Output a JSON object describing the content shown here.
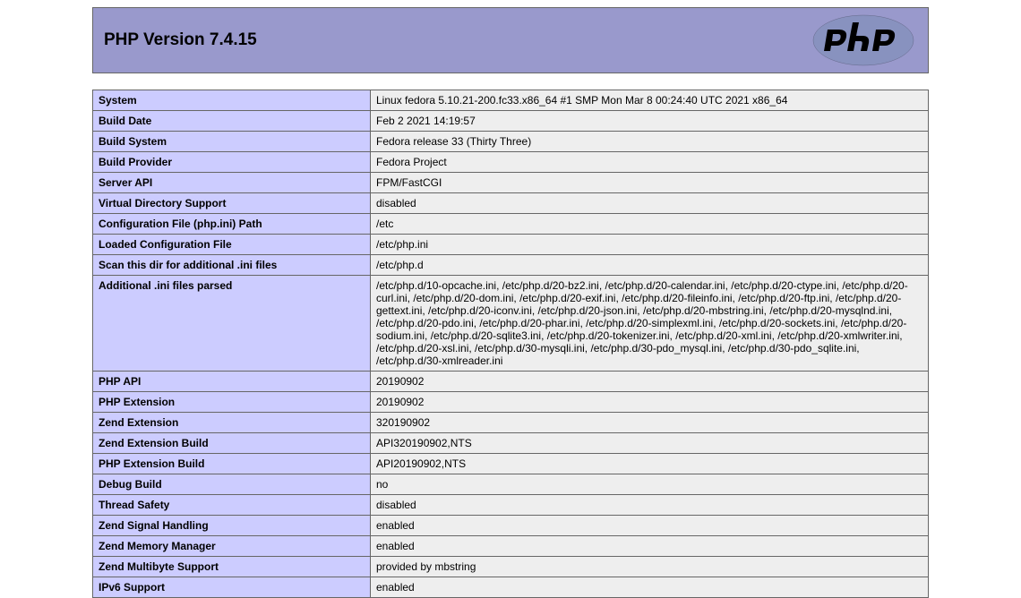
{
  "header": {
    "title": "PHP Version 7.4.15"
  },
  "rows": [
    {
      "label": "System",
      "value": "Linux fedora 5.10.21-200.fc33.x86_64 #1 SMP Mon Mar 8 00:24:40 UTC 2021 x86_64"
    },
    {
      "label": "Build Date",
      "value": "Feb 2 2021 14:19:57"
    },
    {
      "label": "Build System",
      "value": "Fedora release 33 (Thirty Three)"
    },
    {
      "label": "Build Provider",
      "value": "Fedora Project"
    },
    {
      "label": "Server API",
      "value": "FPM/FastCGI"
    },
    {
      "label": "Virtual Directory Support",
      "value": "disabled"
    },
    {
      "label": "Configuration File (php.ini) Path",
      "value": "/etc"
    },
    {
      "label": "Loaded Configuration File",
      "value": "/etc/php.ini"
    },
    {
      "label": "Scan this dir for additional .ini files",
      "value": "/etc/php.d"
    },
    {
      "label": "Additional .ini files parsed",
      "value": "/etc/php.d/10-opcache.ini, /etc/php.d/20-bz2.ini, /etc/php.d/20-calendar.ini, /etc/php.d/20-ctype.ini, /etc/php.d/20-curl.ini, /etc/php.d/20-dom.ini, /etc/php.d/20-exif.ini, /etc/php.d/20-fileinfo.ini, /etc/php.d/20-ftp.ini, /etc/php.d/20-gettext.ini, /etc/php.d/20-iconv.ini, /etc/php.d/20-json.ini, /etc/php.d/20-mbstring.ini, /etc/php.d/20-mysqlnd.ini, /etc/php.d/20-pdo.ini, /etc/php.d/20-phar.ini, /etc/php.d/20-simplexml.ini, /etc/php.d/20-sockets.ini, /etc/php.d/20-sodium.ini, /etc/php.d/20-sqlite3.ini, /etc/php.d/20-tokenizer.ini, /etc/php.d/20-xml.ini, /etc/php.d/20-xmlwriter.ini, /etc/php.d/20-xsl.ini, /etc/php.d/30-mysqli.ini, /etc/php.d/30-pdo_mysql.ini, /etc/php.d/30-pdo_sqlite.ini, /etc/php.d/30-xmlreader.ini"
    },
    {
      "label": "PHP API",
      "value": "20190902"
    },
    {
      "label": "PHP Extension",
      "value": "20190902"
    },
    {
      "label": "Zend Extension",
      "value": "320190902"
    },
    {
      "label": "Zend Extension Build",
      "value": "API320190902,NTS"
    },
    {
      "label": "PHP Extension Build",
      "value": "API20190902,NTS"
    },
    {
      "label": "Debug Build",
      "value": "no"
    },
    {
      "label": "Thread Safety",
      "value": "disabled"
    },
    {
      "label": "Zend Signal Handling",
      "value": "enabled"
    },
    {
      "label": "Zend Memory Manager",
      "value": "enabled"
    },
    {
      "label": "Zend Multibyte Support",
      "value": "provided by mbstring"
    },
    {
      "label": "IPv6 Support",
      "value": "enabled"
    }
  ]
}
